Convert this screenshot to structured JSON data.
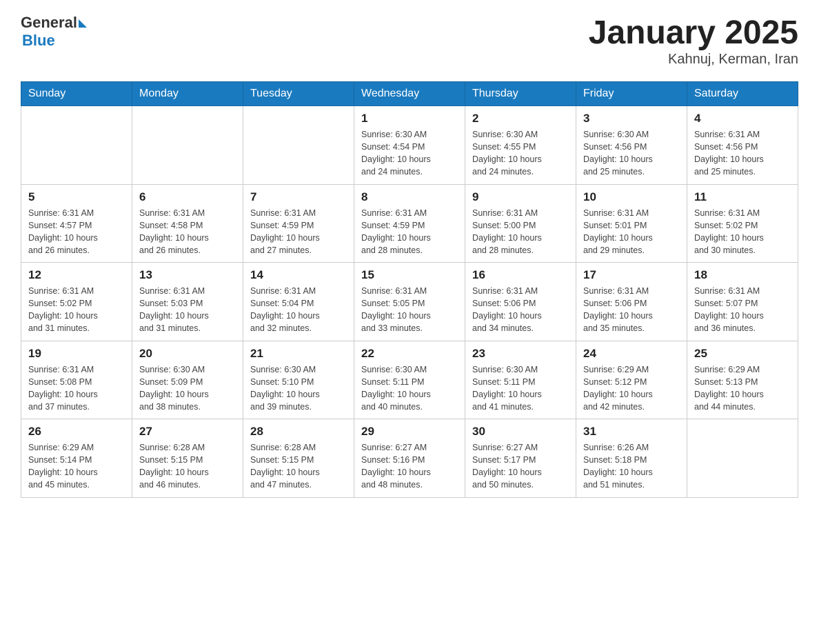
{
  "header": {
    "logo_general": "General",
    "logo_blue": "Blue",
    "title": "January 2025",
    "subtitle": "Kahnuj, Kerman, Iran"
  },
  "days_of_week": [
    "Sunday",
    "Monday",
    "Tuesday",
    "Wednesday",
    "Thursday",
    "Friday",
    "Saturday"
  ],
  "weeks": [
    [
      {
        "day": "",
        "info": ""
      },
      {
        "day": "",
        "info": ""
      },
      {
        "day": "",
        "info": ""
      },
      {
        "day": "1",
        "info": "Sunrise: 6:30 AM\nSunset: 4:54 PM\nDaylight: 10 hours\nand 24 minutes."
      },
      {
        "day": "2",
        "info": "Sunrise: 6:30 AM\nSunset: 4:55 PM\nDaylight: 10 hours\nand 24 minutes."
      },
      {
        "day": "3",
        "info": "Sunrise: 6:30 AM\nSunset: 4:56 PM\nDaylight: 10 hours\nand 25 minutes."
      },
      {
        "day": "4",
        "info": "Sunrise: 6:31 AM\nSunset: 4:56 PM\nDaylight: 10 hours\nand 25 minutes."
      }
    ],
    [
      {
        "day": "5",
        "info": "Sunrise: 6:31 AM\nSunset: 4:57 PM\nDaylight: 10 hours\nand 26 minutes."
      },
      {
        "day": "6",
        "info": "Sunrise: 6:31 AM\nSunset: 4:58 PM\nDaylight: 10 hours\nand 26 minutes."
      },
      {
        "day": "7",
        "info": "Sunrise: 6:31 AM\nSunset: 4:59 PM\nDaylight: 10 hours\nand 27 minutes."
      },
      {
        "day": "8",
        "info": "Sunrise: 6:31 AM\nSunset: 4:59 PM\nDaylight: 10 hours\nand 28 minutes."
      },
      {
        "day": "9",
        "info": "Sunrise: 6:31 AM\nSunset: 5:00 PM\nDaylight: 10 hours\nand 28 minutes."
      },
      {
        "day": "10",
        "info": "Sunrise: 6:31 AM\nSunset: 5:01 PM\nDaylight: 10 hours\nand 29 minutes."
      },
      {
        "day": "11",
        "info": "Sunrise: 6:31 AM\nSunset: 5:02 PM\nDaylight: 10 hours\nand 30 minutes."
      }
    ],
    [
      {
        "day": "12",
        "info": "Sunrise: 6:31 AM\nSunset: 5:02 PM\nDaylight: 10 hours\nand 31 minutes."
      },
      {
        "day": "13",
        "info": "Sunrise: 6:31 AM\nSunset: 5:03 PM\nDaylight: 10 hours\nand 31 minutes."
      },
      {
        "day": "14",
        "info": "Sunrise: 6:31 AM\nSunset: 5:04 PM\nDaylight: 10 hours\nand 32 minutes."
      },
      {
        "day": "15",
        "info": "Sunrise: 6:31 AM\nSunset: 5:05 PM\nDaylight: 10 hours\nand 33 minutes."
      },
      {
        "day": "16",
        "info": "Sunrise: 6:31 AM\nSunset: 5:06 PM\nDaylight: 10 hours\nand 34 minutes."
      },
      {
        "day": "17",
        "info": "Sunrise: 6:31 AM\nSunset: 5:06 PM\nDaylight: 10 hours\nand 35 minutes."
      },
      {
        "day": "18",
        "info": "Sunrise: 6:31 AM\nSunset: 5:07 PM\nDaylight: 10 hours\nand 36 minutes."
      }
    ],
    [
      {
        "day": "19",
        "info": "Sunrise: 6:31 AM\nSunset: 5:08 PM\nDaylight: 10 hours\nand 37 minutes."
      },
      {
        "day": "20",
        "info": "Sunrise: 6:30 AM\nSunset: 5:09 PM\nDaylight: 10 hours\nand 38 minutes."
      },
      {
        "day": "21",
        "info": "Sunrise: 6:30 AM\nSunset: 5:10 PM\nDaylight: 10 hours\nand 39 minutes."
      },
      {
        "day": "22",
        "info": "Sunrise: 6:30 AM\nSunset: 5:11 PM\nDaylight: 10 hours\nand 40 minutes."
      },
      {
        "day": "23",
        "info": "Sunrise: 6:30 AM\nSunset: 5:11 PM\nDaylight: 10 hours\nand 41 minutes."
      },
      {
        "day": "24",
        "info": "Sunrise: 6:29 AM\nSunset: 5:12 PM\nDaylight: 10 hours\nand 42 minutes."
      },
      {
        "day": "25",
        "info": "Sunrise: 6:29 AM\nSunset: 5:13 PM\nDaylight: 10 hours\nand 44 minutes."
      }
    ],
    [
      {
        "day": "26",
        "info": "Sunrise: 6:29 AM\nSunset: 5:14 PM\nDaylight: 10 hours\nand 45 minutes."
      },
      {
        "day": "27",
        "info": "Sunrise: 6:28 AM\nSunset: 5:15 PM\nDaylight: 10 hours\nand 46 minutes."
      },
      {
        "day": "28",
        "info": "Sunrise: 6:28 AM\nSunset: 5:15 PM\nDaylight: 10 hours\nand 47 minutes."
      },
      {
        "day": "29",
        "info": "Sunrise: 6:27 AM\nSunset: 5:16 PM\nDaylight: 10 hours\nand 48 minutes."
      },
      {
        "day": "30",
        "info": "Sunrise: 6:27 AM\nSunset: 5:17 PM\nDaylight: 10 hours\nand 50 minutes."
      },
      {
        "day": "31",
        "info": "Sunrise: 6:26 AM\nSunset: 5:18 PM\nDaylight: 10 hours\nand 51 minutes."
      },
      {
        "day": "",
        "info": ""
      }
    ]
  ]
}
